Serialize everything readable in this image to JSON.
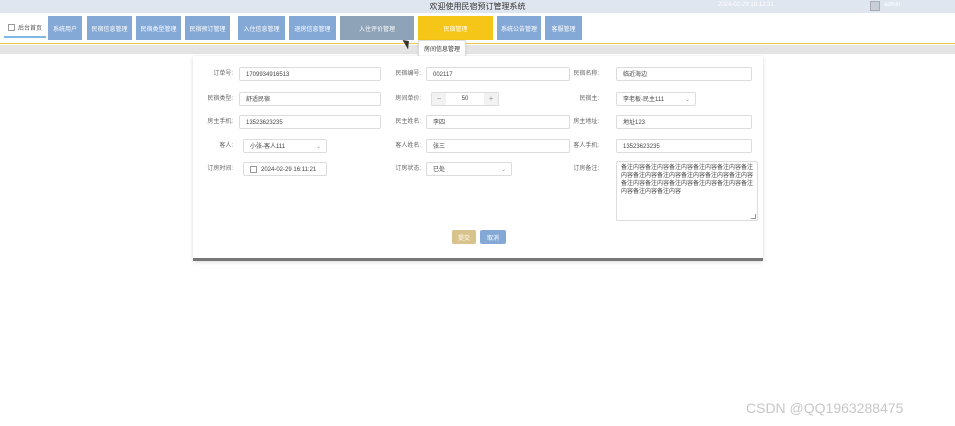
{
  "topbar": {
    "title": "欢迎使用民宿预订管理系统",
    "time": "2024-02-29 16:12:31",
    "user": "admin"
  },
  "nav": {
    "home": "后台首页",
    "items": [
      "系统用户",
      "民宿信息管理",
      "民宿类型管理",
      "民宿预订管理",
      "入住信息管理",
      "退房信息管理",
      "入住评价管理",
      "民宿管理",
      "系统公告管理",
      "客服管理"
    ],
    "dropdown": "房间信息管理"
  },
  "form": {
    "order_no_label": "订单号:",
    "order_no": "1709934916513",
    "house_no_label": "民宿编号:",
    "house_no": "002117",
    "house_name_label": "民宿名称:",
    "house_name": "临近海边",
    "type_label": "民宿类型:",
    "type": "舒适民宿",
    "price_label": "房间单价:",
    "price": "50",
    "owner_label": "民宿主:",
    "owner": "李老板-民主111",
    "owner_phone_label": "房主手机:",
    "owner_phone": "13523623235",
    "owner_name_label": "民主姓名:",
    "owner_name": "李四",
    "owner_addr_label": "房主地址:",
    "owner_addr": "地址123",
    "guest_label": "客人:",
    "guest": "小张-客人111",
    "guest_name_label": "客人姓名:",
    "guest_name": "张三",
    "guest_phone_label": "客人手机:",
    "guest_phone": "13523623235",
    "order_time_label": "订房时间:",
    "order_time": "2024-02-29 16:11:21",
    "status_label": "订房状态:",
    "status": "已处",
    "remark_label": "订房备注:",
    "remark": "备注内容备注内容备注内容备注内容备注内容备注内容备注内容备注内容备注内容备注内容备注内容备注内容备注内容备注内容备注内容备注内容备注内容备注内容备注内容",
    "submit": "提交",
    "cancel": "取消"
  },
  "watermark": "CSDN @QQ1963288475",
  "colors": {
    "nav_button": "#85a9d6",
    "nav_active": "#f5c518",
    "submit": "#d9c38c",
    "cancel": "#85a9d6"
  }
}
